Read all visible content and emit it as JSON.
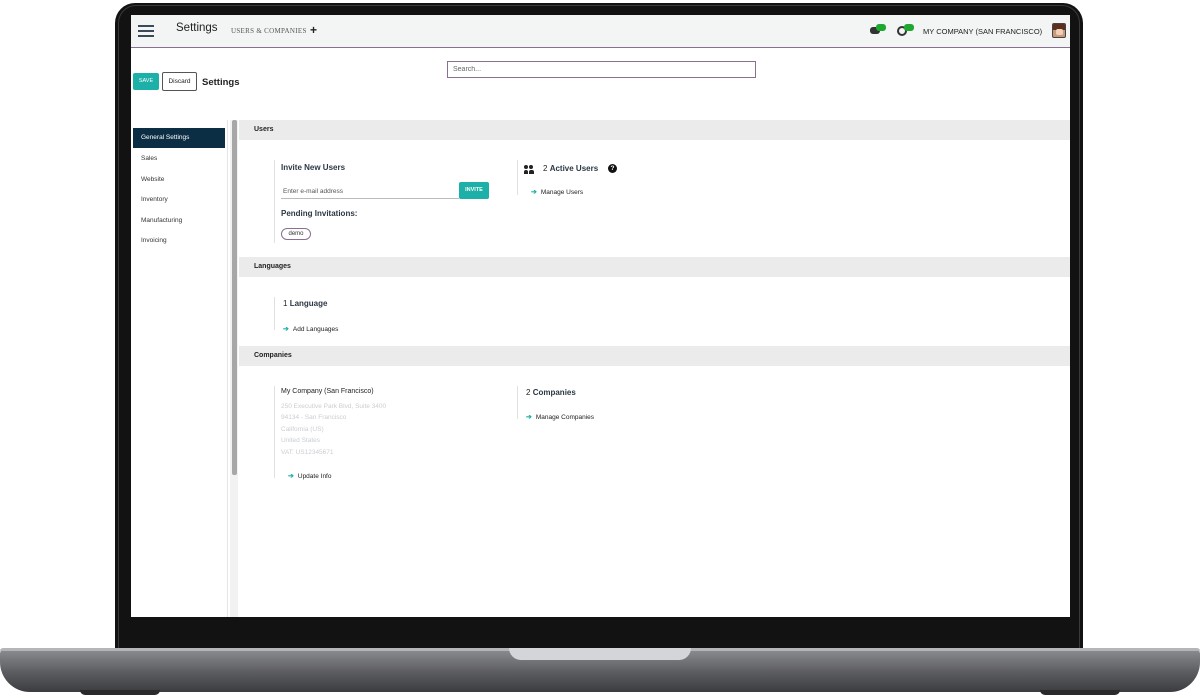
{
  "navbar": {
    "app_title": "Settings",
    "menu_users_companies": "USERS & COMPANIES",
    "new_label": "+",
    "company": "MY COMPANY (SAN FRANCISCO)"
  },
  "control_panel": {
    "save_label": "SAVE",
    "discard_label": "Discard",
    "title": "Settings",
    "search_placeholder": "Search..."
  },
  "sidebar": {
    "items": [
      {
        "label": "General Settings",
        "active": true
      },
      {
        "label": "Sales"
      },
      {
        "label": "Website"
      },
      {
        "label": "Inventory"
      },
      {
        "label": "Manufacturing"
      },
      {
        "label": "Invoicing"
      }
    ]
  },
  "users": {
    "header": "Users",
    "invite_title": "Invite New Users",
    "email_placeholder": "Enter e-mail address",
    "invite_label": "INVITE",
    "pending_title": "Pending Invitations:",
    "pending_tag": "demo",
    "active_count": "2",
    "active_label": "Active Users",
    "help": "?",
    "manage_link": "Manage Users"
  },
  "languages": {
    "header": "Languages",
    "count": "1",
    "label": "Language",
    "add_link": "Add Languages"
  },
  "companies": {
    "header": "Companies",
    "company_name": "My Company (San Francisco)",
    "address_lines": [
      "250 Executive Park Blvd, Suite 3400",
      "94134 - San Francisco",
      "California (US)",
      "United States",
      "VAT:  US12345671"
    ],
    "update_link": "Update Info",
    "count": "2",
    "label": "Companies",
    "manage_link": "Manage Companies"
  },
  "colors": {
    "accent": "#1db0a8",
    "sidebar_active": "#0c2e44",
    "primary_purple": "#8b6f92",
    "status_green": "#1fa82f"
  }
}
